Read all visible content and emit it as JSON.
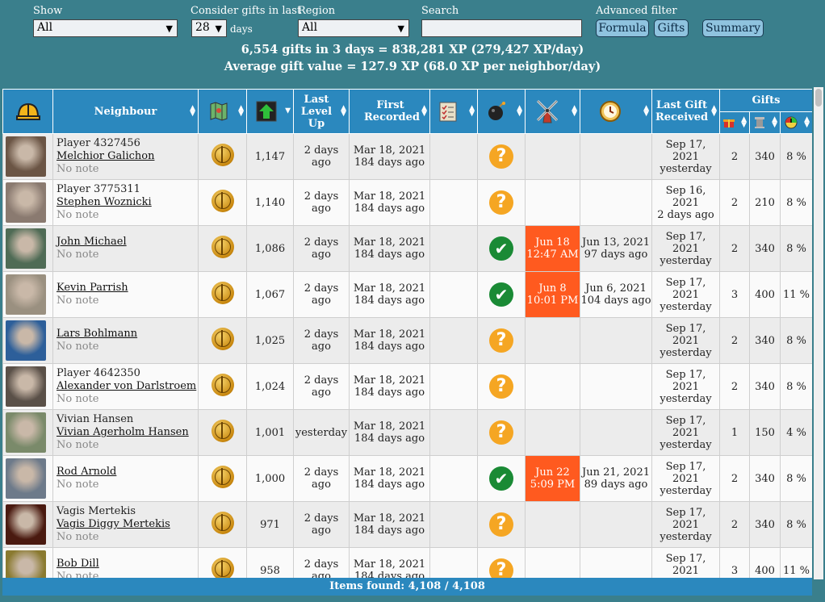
{
  "filters": {
    "show_label": "Show",
    "show_value": "All",
    "consider_label": "Consider gifts in last",
    "consider_value": "28",
    "days_label": "days",
    "region_label": "Region",
    "region_value": "All",
    "search_label": "Search",
    "search_value": "",
    "advanced_label": "Advanced filter",
    "formula_button": "Formula",
    "gifts_button": "Gifts",
    "summary_button": "Summary"
  },
  "summary": {
    "line1": "6,554 gifts in 3 days = 838,281 XP (279,427 XP/day)",
    "line2": "Average gift value = 127.9 XP (68.0 XP per neighbor/day)"
  },
  "columns": {
    "neighbour": "Neighbour",
    "last_level_up": "Last Level Up",
    "first_recorded": "First Recorded",
    "last_gift_received": "Last Gift Received",
    "gifts": "Gifts"
  },
  "rows": [
    {
      "line1": "Player 4327456",
      "link": "Melchior Galichon",
      "note": "No note",
      "level": "1,147",
      "lvlup": "2 days ago",
      "first_date": "Mar 18, 2021",
      "first_ago": "184 days ago",
      "status": "q",
      "wind_date": "",
      "wind_time": "",
      "clock_date": "",
      "clock_ago": "",
      "lg_date": "Sep 17, 2021",
      "lg_ago": "yesterday",
      "g_count": "2",
      "g_xp": "340",
      "g_pct": "8 %",
      "avatar": "#6b5545"
    },
    {
      "line1": "Player 3775311",
      "link": "Stephen Woznicki",
      "note": "No note",
      "level": "1,140",
      "lvlup": "2 days ago",
      "first_date": "Mar 18, 2021",
      "first_ago": "184 days ago",
      "status": "q",
      "wind_date": "",
      "wind_time": "",
      "clock_date": "",
      "clock_ago": "",
      "lg_date": "Sep 16, 2021",
      "lg_ago": "2 days ago",
      "g_count": "2",
      "g_xp": "210",
      "g_pct": "8 %",
      "avatar": "#8a7a70"
    },
    {
      "line1": "",
      "link": "John Michael",
      "note": "No note",
      "level": "1,086",
      "lvlup": "2 days ago",
      "first_date": "Mar 18, 2021",
      "first_ago": "184 days ago",
      "status": "c",
      "wind_date": "Jun 18",
      "wind_time": "12:47 AM",
      "clock_date": "Jun 13, 2021",
      "clock_ago": "97 days ago",
      "lg_date": "Sep 17, 2021",
      "lg_ago": "yesterday",
      "g_count": "2",
      "g_xp": "340",
      "g_pct": "8 %",
      "avatar": "#4f6b55"
    },
    {
      "line1": "",
      "link": "Kevin Parrish",
      "note": "No note",
      "level": "1,067",
      "lvlup": "2 days ago",
      "first_date": "Mar 18, 2021",
      "first_ago": "184 days ago",
      "status": "c",
      "wind_date": "Jun 8",
      "wind_time": "10:01 PM",
      "clock_date": "Jun 6, 2021",
      "clock_ago": "104 days ago",
      "lg_date": "Sep 17, 2021",
      "lg_ago": "yesterday",
      "g_count": "3",
      "g_xp": "400",
      "g_pct": "11 %",
      "avatar": "#9a9080"
    },
    {
      "line1": "",
      "link": "Lars Bohlmann",
      "note": "No note",
      "level": "1,025",
      "lvlup": "2 days ago",
      "first_date": "Mar 18, 2021",
      "first_ago": "184 days ago",
      "status": "q",
      "wind_date": "",
      "wind_time": "",
      "clock_date": "",
      "clock_ago": "",
      "lg_date": "Sep 17, 2021",
      "lg_ago": "yesterday",
      "g_count": "2",
      "g_xp": "340",
      "g_pct": "8 %",
      "avatar": "#2d5f9a"
    },
    {
      "line1": "Player 4642350",
      "link": "Alexander von Darlstroem",
      "note": "No note",
      "level": "1,024",
      "lvlup": "2 days ago",
      "first_date": "Mar 18, 2021",
      "first_ago": "184 days ago",
      "status": "q",
      "wind_date": "",
      "wind_time": "",
      "clock_date": "",
      "clock_ago": "",
      "lg_date": "Sep 17, 2021",
      "lg_ago": "yesterday",
      "g_count": "2",
      "g_xp": "340",
      "g_pct": "8 %",
      "avatar": "#5a5048"
    },
    {
      "line1": "Vivian Hansen",
      "link": "Vivian Agerholm Hansen",
      "note": "No note",
      "level": "1,001",
      "lvlup": "yesterday",
      "first_date": "Mar 18, 2021",
      "first_ago": "184 days ago",
      "status": "q",
      "wind_date": "",
      "wind_time": "",
      "clock_date": "",
      "clock_ago": "",
      "lg_date": "Sep 17, 2021",
      "lg_ago": "yesterday",
      "g_count": "1",
      "g_xp": "150",
      "g_pct": "4 %",
      "avatar": "#7a8a6a"
    },
    {
      "line1": "",
      "link": "Rod Arnold",
      "note": "No note",
      "level": "1,000",
      "lvlup": "2 days ago",
      "first_date": "Mar 18, 2021",
      "first_ago": "184 days ago",
      "status": "c",
      "wind_date": "Jun 22",
      "wind_time": "5:09 PM",
      "clock_date": "Jun 21, 2021",
      "clock_ago": "89 days ago",
      "lg_date": "Sep 17, 2021",
      "lg_ago": "yesterday",
      "g_count": "2",
      "g_xp": "340",
      "g_pct": "8 %",
      "avatar": "#6d7a8a"
    },
    {
      "line1": "Vagis Mertekis",
      "link": "Vagis Diggy Mertekis",
      "note": "No note",
      "level": "971",
      "lvlup": "2 days ago",
      "first_date": "Mar 18, 2021",
      "first_ago": "184 days ago",
      "status": "q",
      "wind_date": "",
      "wind_time": "",
      "clock_date": "",
      "clock_ago": "",
      "lg_date": "Sep 17, 2021",
      "lg_ago": "yesterday",
      "g_count": "2",
      "g_xp": "340",
      "g_pct": "8 %",
      "avatar": "#4a1a10"
    },
    {
      "line1": "",
      "link": "Bob Dill",
      "note": "No note",
      "level": "958",
      "lvlup": "2 days ago",
      "first_date": "Mar 18, 2021",
      "first_ago": "184 days ago",
      "status": "q",
      "wind_date": "",
      "wind_time": "",
      "clock_date": "",
      "clock_ago": "",
      "lg_date": "Sep 17, 2021",
      "lg_ago": "yesterday",
      "g_count": "3",
      "g_xp": "400",
      "g_pct": "11 %",
      "avatar": "#8a7a30"
    }
  ],
  "footer": "Items found: 4,108 / 4,108",
  "colors": {
    "header": "#2b88be",
    "background": "#3a7f8c",
    "highlight": "#ff5a1f",
    "question": "#f5a623",
    "check": "#1a8a35"
  }
}
